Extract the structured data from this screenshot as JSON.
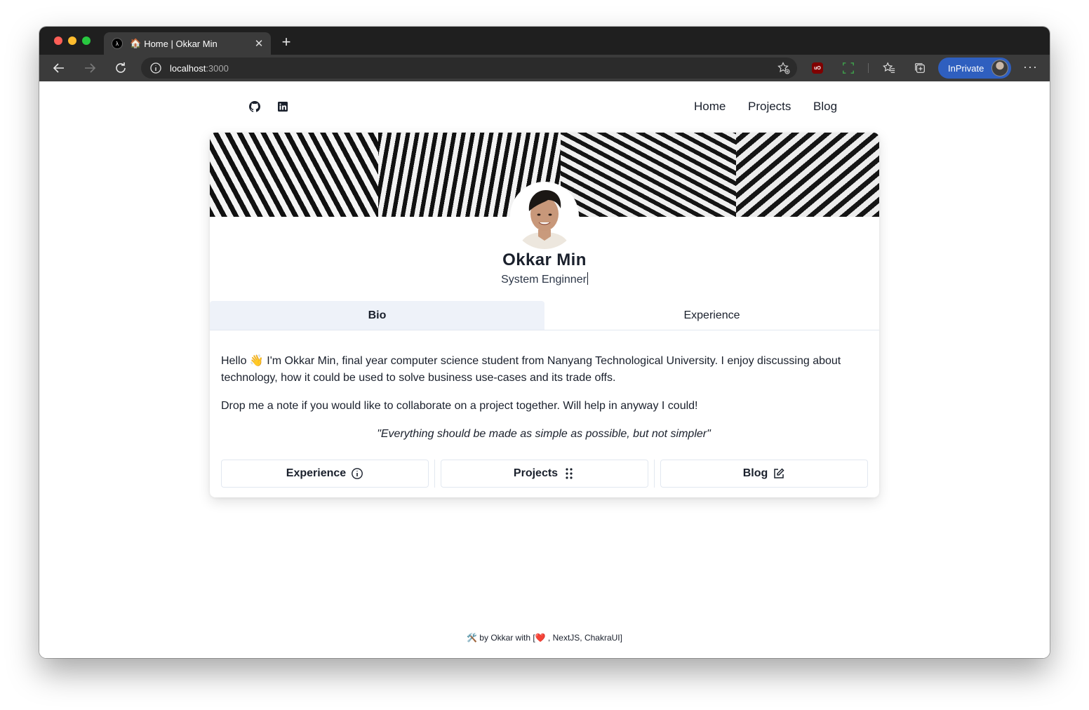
{
  "browser": {
    "tab_emoji": "🏠",
    "tab_title": "Home | Okkar Min",
    "favicon_glyph": "λ",
    "tab_close": "✕",
    "new_tab": "+",
    "url_host": "localhost",
    "url_port": ":3000",
    "inprivate_label": "InPrivate",
    "more_label": "···"
  },
  "nav": {
    "social": [
      {
        "name": "github-icon"
      },
      {
        "name": "linkedin-icon"
      }
    ],
    "links": [
      "Home",
      "Projects",
      "Blog"
    ]
  },
  "profile": {
    "name": "Okkar Min",
    "role": "System Enginner"
  },
  "tabs": {
    "bio": "Bio",
    "experience": "Experience"
  },
  "bio": {
    "paragraph1": "Hello 👋 I'm Okkar Min, final year computer science student from Nanyang Technological University. I enjoy discussing about technology, how it could be used to solve business use-cases and its trade offs.",
    "paragraph2": "Drop me a note if you would like to collaborate on a project together. Will help in anyway I could!",
    "quote": "\"Everything should be made as simple as possible, but not simpler\""
  },
  "actions": {
    "experience": "Experience",
    "projects": "Projects",
    "blog": "Blog"
  },
  "footer": {
    "text": "🛠️ by Okkar with [❤️ , NextJS, ChakraUI]"
  },
  "colors": {
    "accent": "#2f5fbf",
    "active_tab_bg": "#eef2f9",
    "text": "#1a202c"
  }
}
